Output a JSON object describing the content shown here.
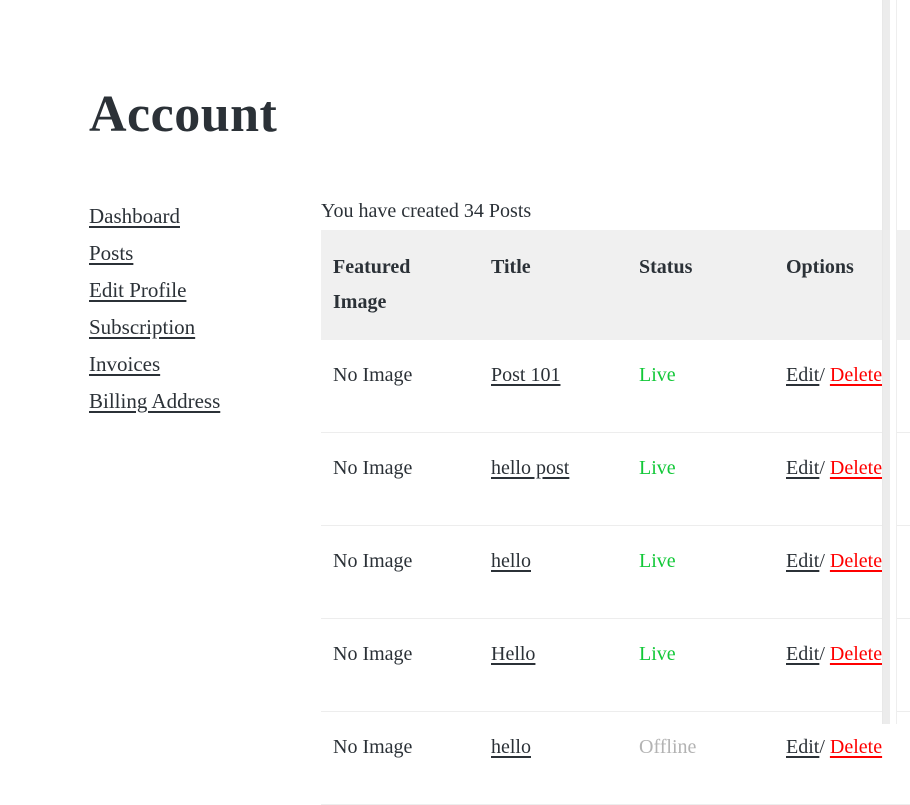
{
  "page": {
    "title": "Account"
  },
  "sidebar": {
    "items": [
      {
        "label": "Dashboard"
      },
      {
        "label": "Posts"
      },
      {
        "label": "Edit Profile"
      },
      {
        "label": "Subscription"
      },
      {
        "label": "Invoices"
      },
      {
        "label": "Billing Address"
      }
    ]
  },
  "main": {
    "posts_count_text": "You have created 34 Posts",
    "table": {
      "headers": {
        "featured_image": "Featured Image",
        "title": "Title",
        "status": "Status",
        "options": "Options"
      },
      "option_labels": {
        "edit": "Edit",
        "separator": "/",
        "delete": "Delete"
      },
      "rows": [
        {
          "featured_image": "No Image",
          "title": "Post 101",
          "status": "Live",
          "status_state": "live",
          "edit": "Edit",
          "separator": "/",
          "delete": "Delete"
        },
        {
          "featured_image": "No Image",
          "title": "hello post",
          "status": "Live",
          "status_state": "live",
          "edit": "Edit",
          "separator": "/",
          "delete": "Delete"
        },
        {
          "featured_image": "No Image",
          "title": "hello",
          "status": "Live",
          "status_state": "live",
          "edit": "Edit",
          "separator": "/",
          "delete": "Delete"
        },
        {
          "featured_image": "No Image",
          "title": "Hello",
          "status": "Live",
          "status_state": "live",
          "edit": "Edit",
          "separator": "/",
          "delete": "Delete"
        },
        {
          "featured_image": "No Image",
          "title": "hello",
          "status": "Offline",
          "status_state": "offline",
          "edit": "Edit",
          "separator": "/",
          "delete": "Delete"
        }
      ]
    }
  },
  "colors": {
    "text": "#2b3137",
    "live": "#12c838",
    "offline": "#b3b3b3",
    "delete": "#ff0000",
    "header_background": "#f0f0f0",
    "row_divider": "#ededed"
  }
}
